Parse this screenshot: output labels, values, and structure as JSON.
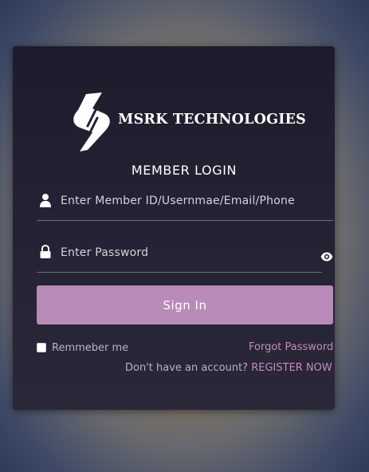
{
  "brand": {
    "name": "MSRK TECHNOLOGIES",
    "logo_icon": "msrk-logo-icon"
  },
  "login": {
    "title": "MEMBER LOGIN",
    "username": {
      "icon": "user-icon",
      "value": "",
      "placeholder": "Enter Member ID/Usernmae/Email/Phone"
    },
    "password": {
      "icon": "lock-icon",
      "value": "",
      "placeholder": "Enter Password",
      "toggle_icon": "eye-icon"
    },
    "signin_label": "Sign In",
    "remember_label": "Remmeber me",
    "remember_checked": false,
    "forgot_label": "Forgot Password",
    "register_prompt": "Don't have an account?",
    "register_label": "REGISTER NOW"
  },
  "colors": {
    "accent": "#b88bb8",
    "link": "#c48ac0",
    "card_bg": "#221f2f",
    "text": "#ffffff",
    "muted_text": "#b7b5c0"
  }
}
